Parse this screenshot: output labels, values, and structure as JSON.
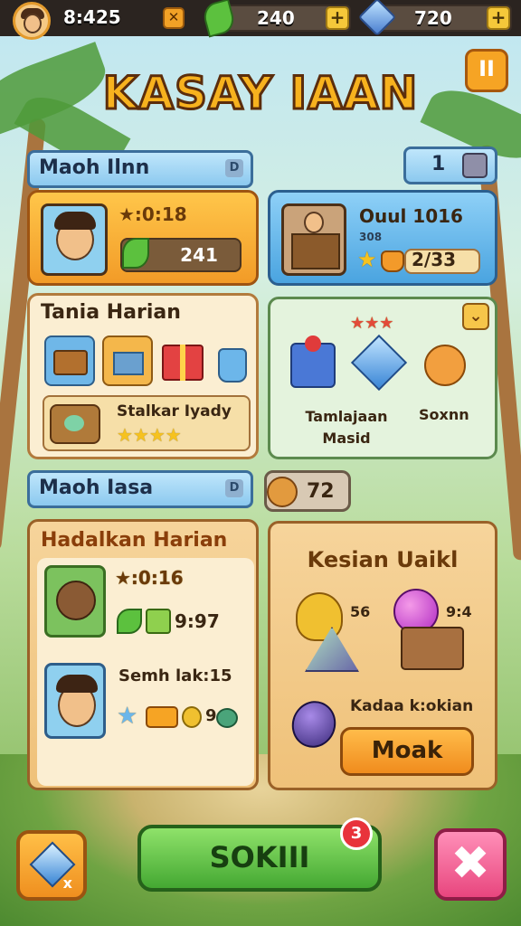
{
  "topbar": {
    "time": "8:425",
    "timer_icon": "timer-icon",
    "leaves": "240",
    "gems": "720",
    "plus": "+"
  },
  "title": "KASAY IAAN",
  "pause_label": "II",
  "section1": {
    "header": "Maoh Ilnn",
    "header_badge": "D",
    "counter": "1"
  },
  "player_card": {
    "score": "★:0:18",
    "leaves": "241"
  },
  "quest_card": {
    "title": "Ouul 1016",
    "sub": "308",
    "value": "2/33"
  },
  "daily": {
    "title": "Tania Harian",
    "sticker_label": "Stalkar Iyady",
    "stars": "★★★★"
  },
  "rewards_panel": {
    "left_label": "Tamlajaan Masid",
    "right_label": "Soxnn",
    "ribbon": "★★★"
  },
  "section2": {
    "header": "Maoh Iasa",
    "header_badge": "D",
    "counter": "72"
  },
  "missions": {
    "title": "Hadalkan Harian",
    "row1_score": "★:0:16",
    "row1_value": "9:97",
    "row2_title": "Semh lak:15",
    "row2_value": "9"
  },
  "shop": {
    "title": "Kesian Uaikl",
    "item1_value": "56",
    "item2_value": "9:4",
    "item3_label": "Kadaa k:okian",
    "button": "Moak"
  },
  "bottom": {
    "main_button": "SOKIII",
    "badge": "3",
    "left_badge": "x",
    "close": "✖"
  },
  "colors": {
    "accent_orange": "#f6a424",
    "accent_blue": "#4aa4e0",
    "accent_green": "#44a832",
    "accent_pink": "#e8467e"
  }
}
